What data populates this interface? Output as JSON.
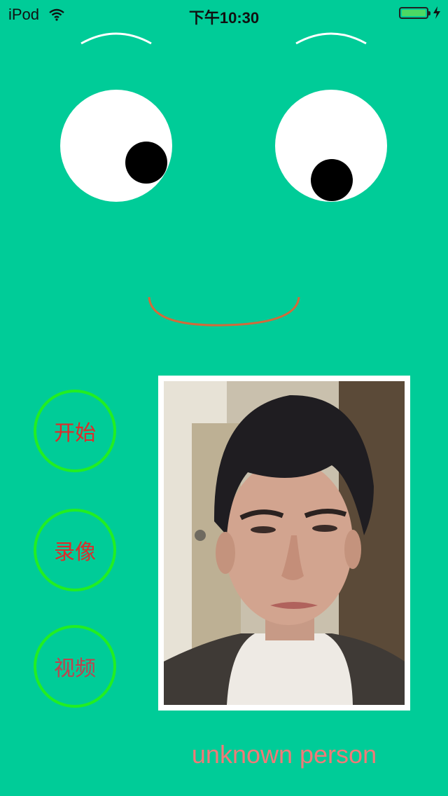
{
  "status_bar": {
    "device": "iPod",
    "time": "下午10:30"
  },
  "buttons": {
    "start": "开始",
    "record": "录像",
    "video": "视频"
  },
  "recognition": {
    "result": "unknown person"
  },
  "colors": {
    "background": "#00cc98",
    "button_ring": "#22ee22",
    "button_text": "#e02a2a",
    "mouth": "#d36a3a",
    "result_text": "#f07a78"
  },
  "icons": {
    "wifi": "wifi-icon",
    "battery": "battery-icon",
    "charging": "charging-bolt-icon"
  }
}
